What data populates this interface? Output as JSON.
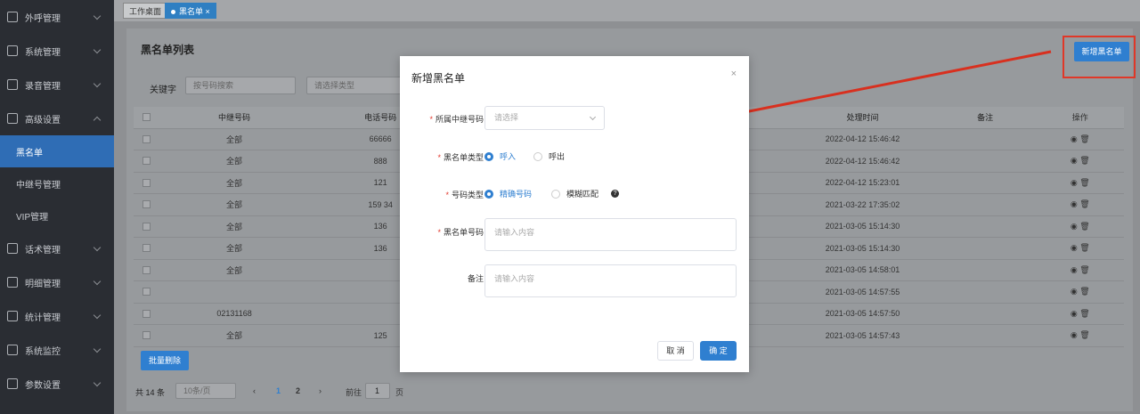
{
  "sidebar": {
    "items": [
      {
        "label": "外呼管理",
        "icon": "phone-out-icon"
      },
      {
        "label": "系统管理",
        "icon": "gear-icon"
      },
      {
        "label": "录音管理",
        "icon": "phone-icon"
      },
      {
        "label": "高级设置",
        "icon": "edit-icon"
      },
      {
        "label": "黑名单",
        "sub": true,
        "active": true
      },
      {
        "label": "中继号管理",
        "sub": true
      },
      {
        "label": "VIP管理",
        "sub": true
      },
      {
        "label": "话术管理",
        "icon": "chat-icon"
      },
      {
        "label": "明细管理",
        "icon": "list-icon"
      },
      {
        "label": "统计管理",
        "icon": "chart-icon"
      },
      {
        "label": "系统监控",
        "icon": "monitor-icon"
      },
      {
        "label": "参数设置",
        "icon": "settings-icon"
      }
    ]
  },
  "tabs": {
    "home": "工作桌面",
    "current": "黑名单",
    "close": "×"
  },
  "page": {
    "title": "黑名单列表",
    "new_button": "新增黑名单",
    "filter_label": "关键字",
    "search_placeholder": "按号码搜索",
    "type_placeholder": "请选择类型",
    "batch_delete": "批量删除"
  },
  "table": {
    "headers": {
      "trunk": "中继号码",
      "phone": "电话号码",
      "time": "处理时间",
      "note": "备注",
      "ops": "操作"
    },
    "rows": [
      {
        "trunk": "全部",
        "phone": "66666",
        "time": "2022-04-12 15:46:42"
      },
      {
        "trunk": "全部",
        "phone": "888",
        "time": "2022-04-12 15:46:42"
      },
      {
        "trunk": "全部",
        "phone": "121",
        "time": "2022-04-12 15:23:01"
      },
      {
        "trunk": "全部",
        "phone": "159    34",
        "time": "2021-03-22 17:35:02"
      },
      {
        "trunk": "全部",
        "phone": "136",
        "time": "2021-03-05 15:14:30"
      },
      {
        "trunk": "全部",
        "phone": "136",
        "time": "2021-03-05 15:14:30"
      },
      {
        "trunk": "全部",
        "phone": "",
        "time": "2021-03-05 14:58:01"
      },
      {
        "trunk": "",
        "phone": "",
        "time": "2021-03-05 14:57:55"
      },
      {
        "trunk": "02131168",
        "phone": "",
        "time": "2021-03-05 14:57:50"
      },
      {
        "trunk": "全部",
        "phone": "125",
        "time": "2021-03-05 14:57:43"
      }
    ]
  },
  "pager": {
    "total": "共 14 条",
    "size": "10条/页",
    "p1": "1",
    "p2": "2",
    "goto": "前往",
    "page_input": "1",
    "page_unit": "页",
    "prev": "‹",
    "next": "›"
  },
  "modal": {
    "title": "新增黑名单",
    "close": "×",
    "trunk_label": "所属中继号码",
    "trunk_placeholder": "请选择",
    "type_label": "黑名单类型",
    "in": "呼入",
    "out": "呼出",
    "numtype_label": "号码类型",
    "exact": "精确号码",
    "fuzzy": "模糊匹配",
    "help": "?",
    "number_label": "黑名单号码",
    "number_placeholder": "请输入内容",
    "note_label": "备注",
    "note_placeholder": "请输入内容",
    "cancel": "取 消",
    "ok": "确 定"
  },
  "colors": {
    "primary": "#2f7fd0",
    "annotation": "#e03828"
  }
}
